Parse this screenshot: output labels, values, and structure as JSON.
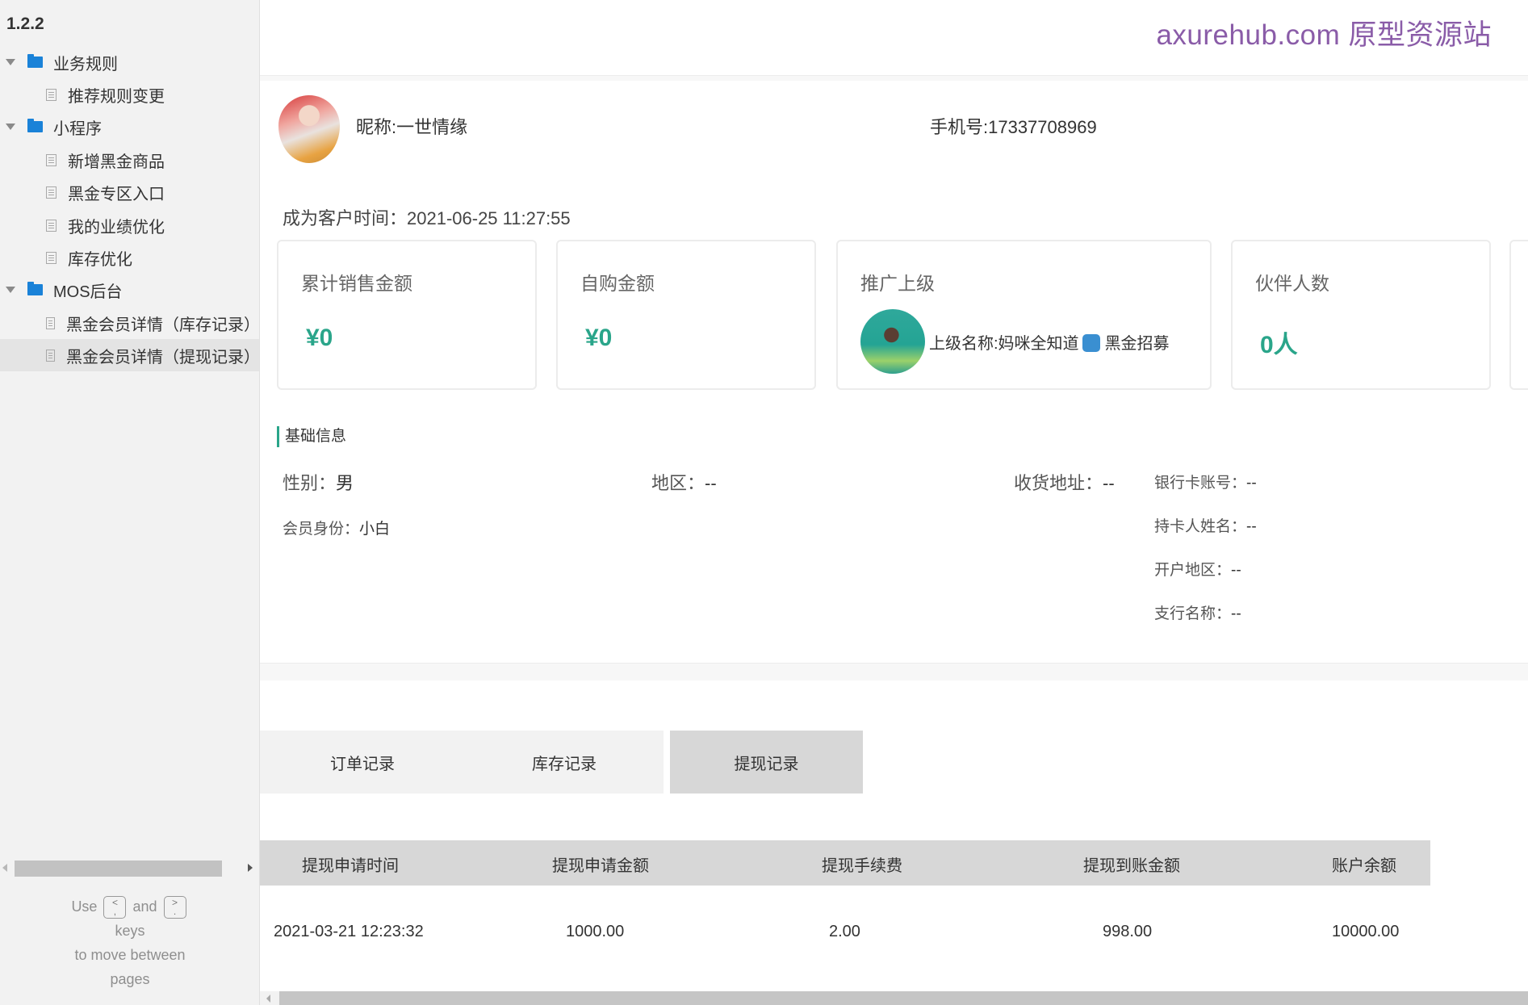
{
  "sidebar": {
    "version": "1.2.2",
    "tree": [
      {
        "type": "folder",
        "label": "业务规则"
      },
      {
        "type": "page",
        "label": "推荐规则变更"
      },
      {
        "type": "folder",
        "label": "小程序"
      },
      {
        "type": "page",
        "label": "新增黑金商品"
      },
      {
        "type": "page",
        "label": "黑金专区入口"
      },
      {
        "type": "page",
        "label": "我的业绩优化"
      },
      {
        "type": "page",
        "label": "库存优化"
      },
      {
        "type": "folder",
        "label": "MOS后台"
      },
      {
        "type": "page",
        "label": "黑金会员详情（库存记录）"
      },
      {
        "type": "page",
        "label": "黑金会员详情（提现记录）",
        "selected": true
      }
    ],
    "keys_hint": {
      "use": "Use",
      "prev_key_top": "<",
      "prev_key_bottom": ",",
      "and": "and",
      "next_key_top": ">",
      "next_key_bottom": ".",
      "keys": "keys",
      "line2": "to move between",
      "line3": "pages"
    }
  },
  "watermark": "axurehub.com 原型资源站",
  "profile": {
    "nickname": "昵称:一世情缘",
    "phone": "手机号:17337708969",
    "join_time": "成为客户时间：2021-06-25 11:27:55"
  },
  "stats": [
    {
      "title": "累计销售金额",
      "value": "¥0"
    },
    {
      "title": "自购金额",
      "value": "¥0"
    },
    {
      "title": "推广上级",
      "upline_label": "上级名称:妈咪全知道",
      "upline_suffix": "黑金招募"
    },
    {
      "title": "伙伴人数",
      "value": "0人"
    }
  ],
  "basic_info": {
    "title": "基础信息",
    "gender": {
      "label": "性别：",
      "value": "男"
    },
    "region": {
      "label": "地区：",
      "value": "--"
    },
    "address": {
      "label": "收货地址：",
      "value": "--"
    },
    "member_level": {
      "label": "会员身份：",
      "value": "小白"
    },
    "bank_account": {
      "label": "银行卡账号：",
      "value": "--"
    },
    "card_holder": {
      "label": "持卡人姓名：",
      "value": "--"
    },
    "bank_region": {
      "label": "开户地区：",
      "value": "--"
    },
    "branch_name": {
      "label": "支行名称：",
      "value": "--"
    }
  },
  "tabs": [
    {
      "label": "订单记录",
      "active": false
    },
    {
      "label": "库存记录",
      "active": false
    },
    {
      "label": "提现记录",
      "active": true
    }
  ],
  "withdraw_table": {
    "columns": [
      "提现申请时间",
      "提现申请金额",
      "提现手续费",
      "提现到账金额",
      "账户余额"
    ],
    "rows": [
      [
        "2021-03-21 12:23:32",
        "1000.00",
        "2.00",
        "998.00",
        "10000.00"
      ]
    ]
  },
  "colors": {
    "accent": "#2aa58a",
    "watermark": "#8a5ca8",
    "folder": "#1a82d8"
  }
}
